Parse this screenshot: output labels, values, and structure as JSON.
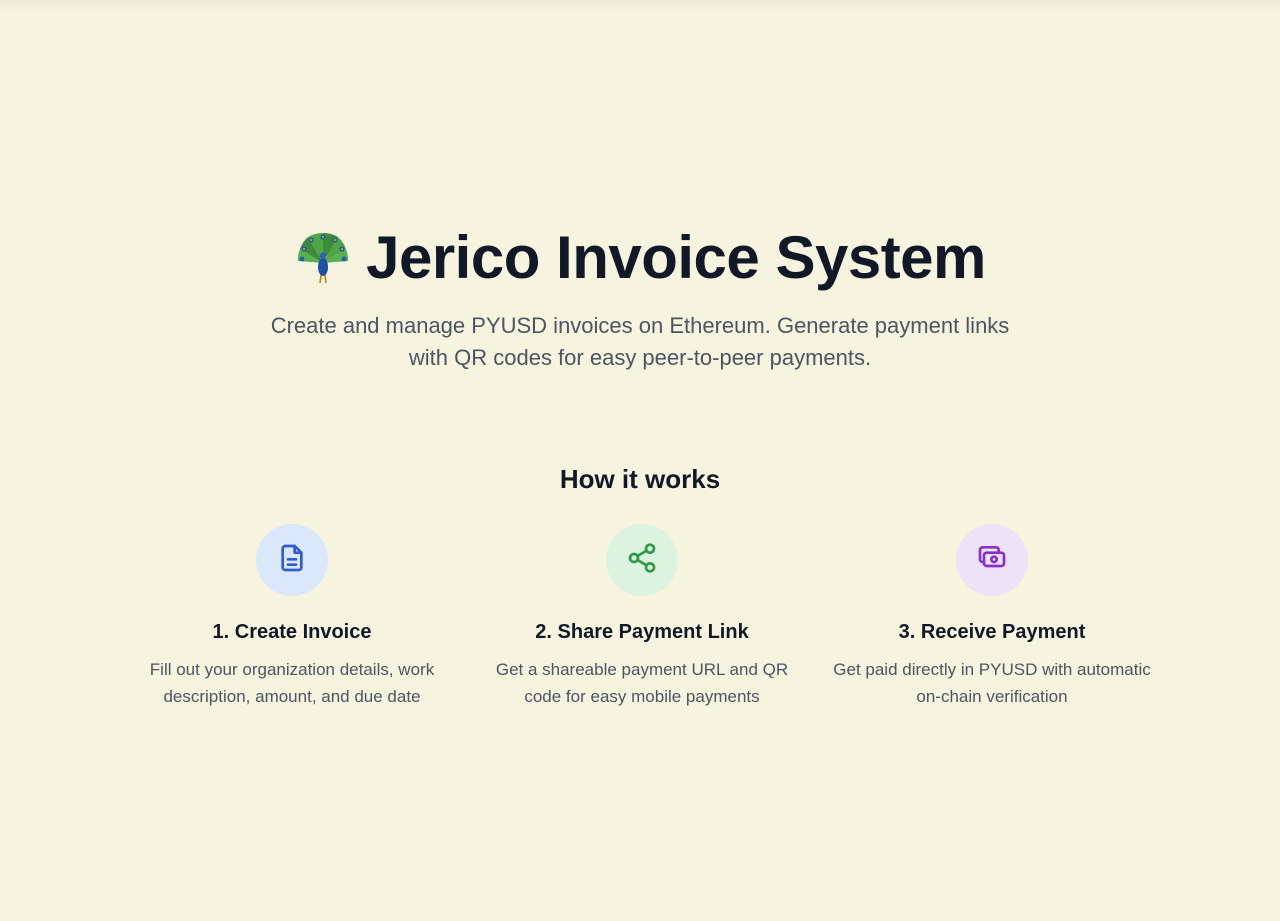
{
  "hero": {
    "title": "Jerico Invoice System",
    "logo_icon": "peacock-icon",
    "subtitle": "Create and manage PYUSD invoices on Ethereum. Generate payment links with QR codes for easy peer-to-peer payments."
  },
  "how_it_works": {
    "title": "How it works",
    "steps": [
      {
        "icon": "document-icon",
        "icon_color": "#2f5bd3",
        "circle_color": "#dbe7fb",
        "title": "1. Create Invoice",
        "description": "Fill out your organization details, work description, amount, and due date"
      },
      {
        "icon": "share-icon",
        "icon_color": "#2f9a48",
        "circle_color": "#dcf3df",
        "title": "2. Share Payment Link",
        "description": "Get a shareable payment URL and QR code for easy mobile payments"
      },
      {
        "icon": "cash-icon",
        "icon_color": "#8a2fc9",
        "circle_color": "#ece3f8",
        "title": "3. Receive Payment",
        "description": "Get paid directly in PYUSD with automatic on-chain verification"
      }
    ]
  },
  "colors": {
    "background": "#f6f4df",
    "heading": "#111827",
    "body_text": "#4b5563"
  }
}
